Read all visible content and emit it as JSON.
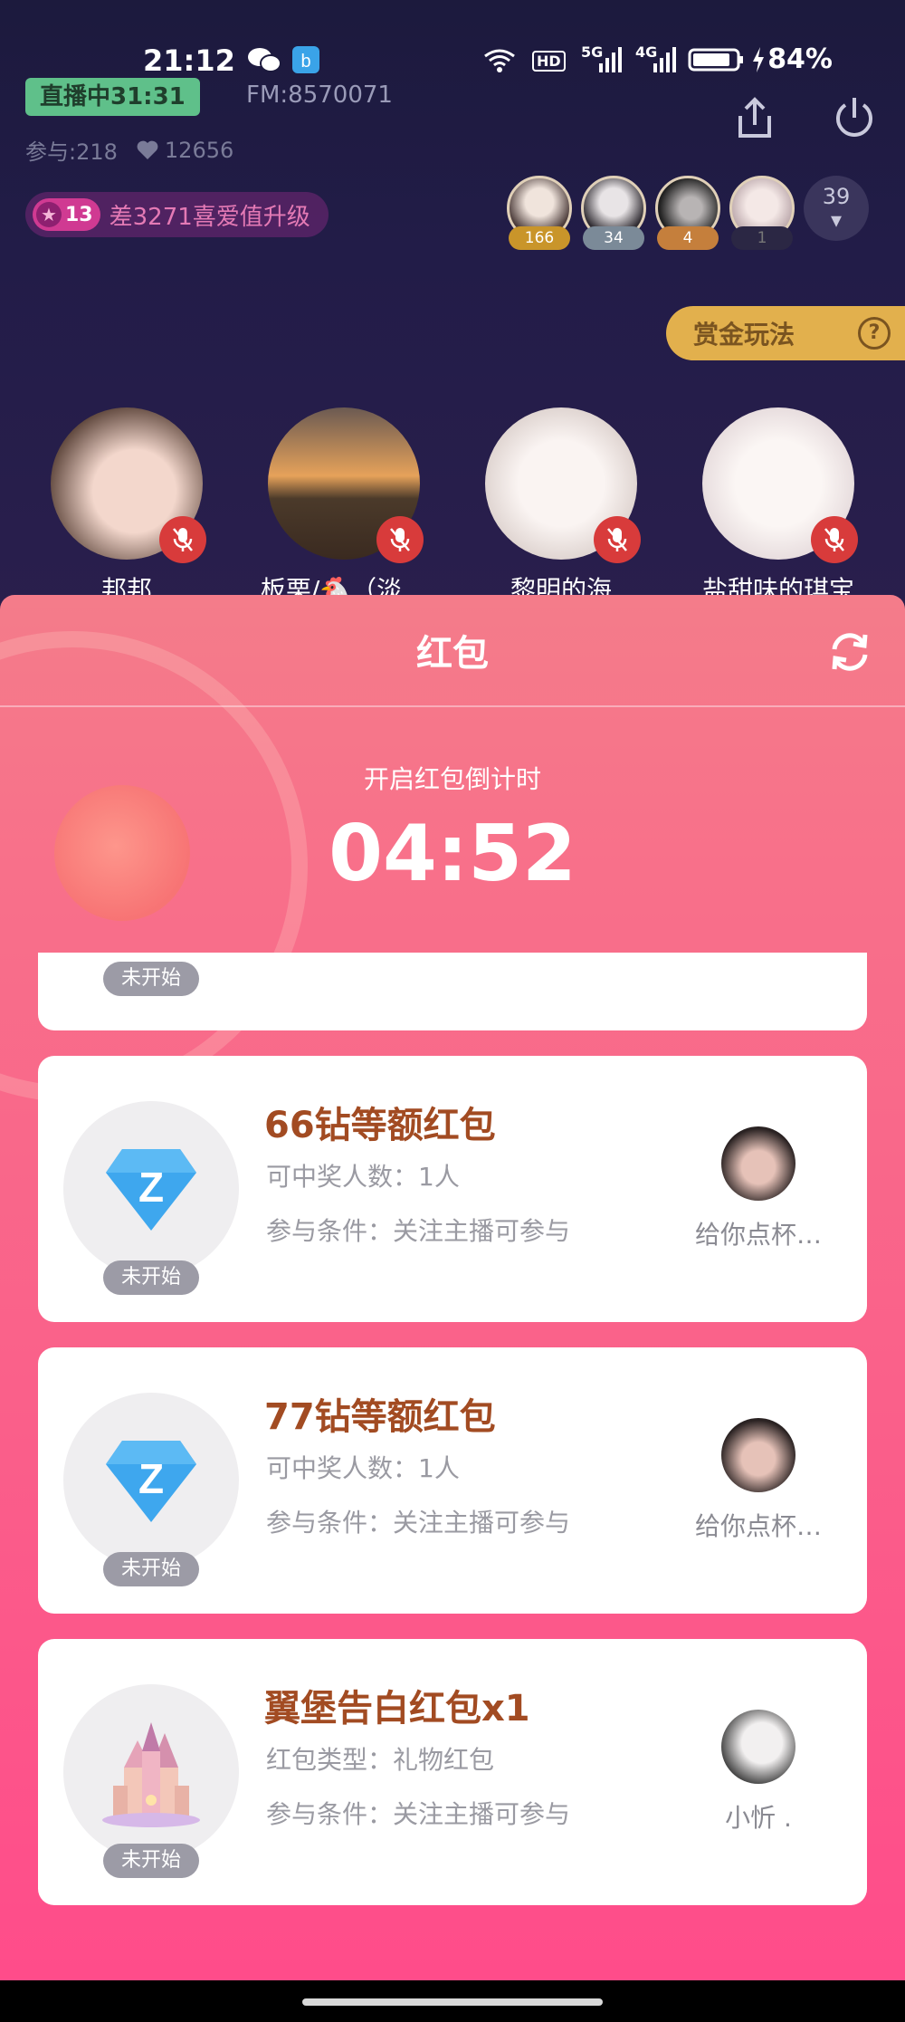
{
  "status_bar": {
    "time": "21:12",
    "network_hd": "HD",
    "network_5g": "5G",
    "network_4g": "4G",
    "battery": "84%"
  },
  "room": {
    "live_badge": "直播中31:31",
    "fm_id": "FM:8570071",
    "participants": "参与:218",
    "likes": "12656",
    "level": "13",
    "level_text": "差3271喜爱值升级",
    "viewer_ranks": [
      "166",
      "34",
      "4",
      "1"
    ],
    "viewer_count": "39",
    "bounty_label": "赏金玩法",
    "seats": [
      "邦邦",
      "板栗/🐔（淡…",
      "黎明的海",
      "盐甜味的琪宝"
    ]
  },
  "red_packet": {
    "title": "红包",
    "countdown_label": "开启红包倒计时",
    "countdown": "04:52",
    "cards": [
      {
        "status": "未开始",
        "title": "66钻等额红包",
        "line1": "可中奖人数：1人",
        "line2": "参与条件：关注主播可参与",
        "host": "给你点杯…",
        "icon": "diamond-z-icon"
      },
      {
        "status": "未开始",
        "title": "77钻等额红包",
        "line1": "可中奖人数：1人",
        "line2": "参与条件：关注主播可参与",
        "host": "给你点杯…",
        "icon": "diamond-z-icon"
      },
      {
        "status": "未开始",
        "title": "翼堡告白红包x1",
        "line1": "红包类型：礼物红包",
        "line2": "参与条件：关注主播可参与",
        "host": "小忻 .",
        "icon": "castle-gift-icon"
      }
    ],
    "partial_card_status": "未开始"
  },
  "colors": {
    "live_badge": "#5fc08a",
    "bounty": "#e2b04d",
    "card_title": "#a24b22",
    "sheet_top": "#f47c8a",
    "sheet_bottom": "#ff4c8a"
  }
}
